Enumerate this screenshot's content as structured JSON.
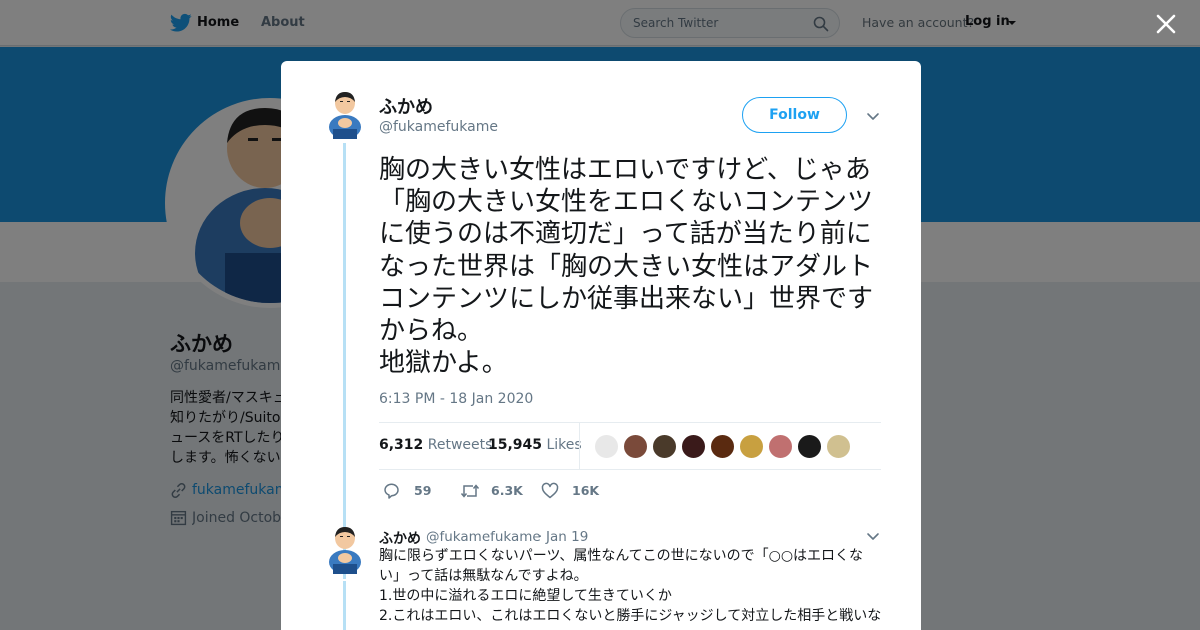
{
  "topbar": {
    "home_label": "Home",
    "about_label": "About",
    "search_placeholder": "Search Twitter",
    "account_prompt": "Have an account?",
    "login_label": "Log in"
  },
  "profile": {
    "name": "ふかめ",
    "handle": "@fukamefukame",
    "bio_lines": [
      "同性愛者/マスキュ",
      "知りたがり/Suitoc",
      "ュースをRTしたり",
      "します。怖くない"
    ],
    "link": "fukamefukame",
    "joined": "Joined Octobe"
  },
  "tweet": {
    "name": "ふかめ",
    "handle": "@fukamefukame",
    "follow_label": "Follow",
    "text": "胸の大きい女性はエロいですけど、じゃあ「胸の大きい女性をエロくないコンテンツに使うのは不適切だ」って話が当たり前になった世界は「胸の大きい女性はアダルトコンテンツにしか従事出来ない」世界ですからね。\n地獄かよ。",
    "timestamp": "6:13 PM - 18 Jan 2020",
    "retweets_count": "6,312",
    "retweets_label": "Retweets",
    "likes_count": "15,945",
    "likes_label": "Likes",
    "liker_colors": [
      "#e8e8e8",
      "#7a4a3a",
      "#4a3a2a",
      "#3a1a1a",
      "#5a2a10",
      "#c8a040",
      "#c07070",
      "#1a1a1a",
      "#d0c090"
    ],
    "reply_count": "59",
    "retweet_count_short": "6.3K",
    "like_count_short": "16K"
  },
  "reply": {
    "name": "ふかめ",
    "handle": "@fukamefukame",
    "separator": "·",
    "date": "Jan 19",
    "lines": [
      "胸に限らずエロくないパーツ、属性なんてこの世にないので「○○はエロくな",
      "い」って話は無駄なんですよね。",
      "1.世の中に溢れるエロに絶望して生きていくか",
      "2.これはエロい、これはエロくないと勝手にジャッジして対立した相手と戦いな"
    ]
  },
  "colors": {
    "brand": "#1da1f2",
    "banner": "#1b95e0"
  }
}
